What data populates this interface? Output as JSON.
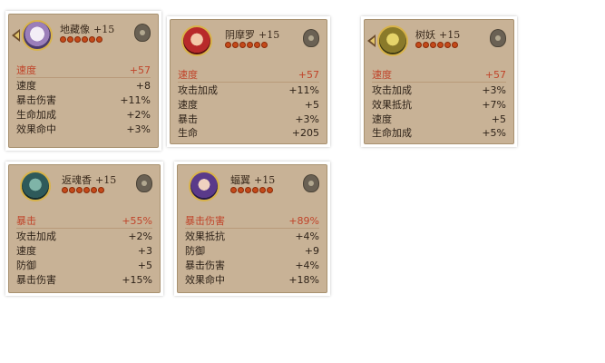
{
  "cards": [
    {
      "name": "地藏像",
      "level": "+15",
      "stars": 6,
      "stats": [
        {
          "label": "速度",
          "value": "+57",
          "main": true
        },
        {
          "label": "速度",
          "value": "+8"
        },
        {
          "label": "暴击伤害",
          "value": "+11%"
        },
        {
          "label": "生命加成",
          "value": "+2%"
        },
        {
          "label": "效果命中",
          "value": "+3%"
        }
      ]
    },
    {
      "name": "阴摩罗",
      "level": "+15",
      "stars": 6,
      "stats": [
        {
          "label": "速度",
          "value": "+57",
          "main": true
        },
        {
          "label": "攻击加成",
          "value": "+11%"
        },
        {
          "label": "速度",
          "value": "+5"
        },
        {
          "label": "暴击",
          "value": "+3%"
        },
        {
          "label": "生命",
          "value": "+205"
        }
      ]
    },
    {
      "name": "树妖",
      "level": "+15",
      "stars": 6,
      "stats": [
        {
          "label": "速度",
          "value": "+57",
          "main": true
        },
        {
          "label": "攻击加成",
          "value": "+3%"
        },
        {
          "label": "效果抵抗",
          "value": "+7%"
        },
        {
          "label": "速度",
          "value": "+5"
        },
        {
          "label": "生命加成",
          "value": "+5%"
        }
      ]
    },
    {
      "name": "返魂香",
      "level": "+15",
      "stars": 6,
      "stats": [
        {
          "label": "暴击",
          "value": "+55%",
          "main": true
        },
        {
          "label": "攻击加成",
          "value": "+2%"
        },
        {
          "label": "速度",
          "value": "+3"
        },
        {
          "label": "防御",
          "value": "+5"
        },
        {
          "label": "暴击伤害",
          "value": "+15%"
        }
      ]
    },
    {
      "name": "蝠翼",
      "level": "+15",
      "stars": 6,
      "stats": [
        {
          "label": "暴击伤害",
          "value": "+89%",
          "main": true
        },
        {
          "label": "效果抵抗",
          "value": "+4%"
        },
        {
          "label": "防御",
          "value": "+9"
        },
        {
          "label": "暴击伤害",
          "value": "+4%"
        },
        {
          "label": "效果命中",
          "value": "+18%"
        }
      ]
    }
  ],
  "icons": {
    "avatar_frame": "arrow-frame-icon",
    "lock": "lock-icon",
    "star": "star-icon"
  },
  "colors": {
    "main_stat": "#c0442a",
    "panel_bg": "#c8b296",
    "text": "#2e2218"
  }
}
